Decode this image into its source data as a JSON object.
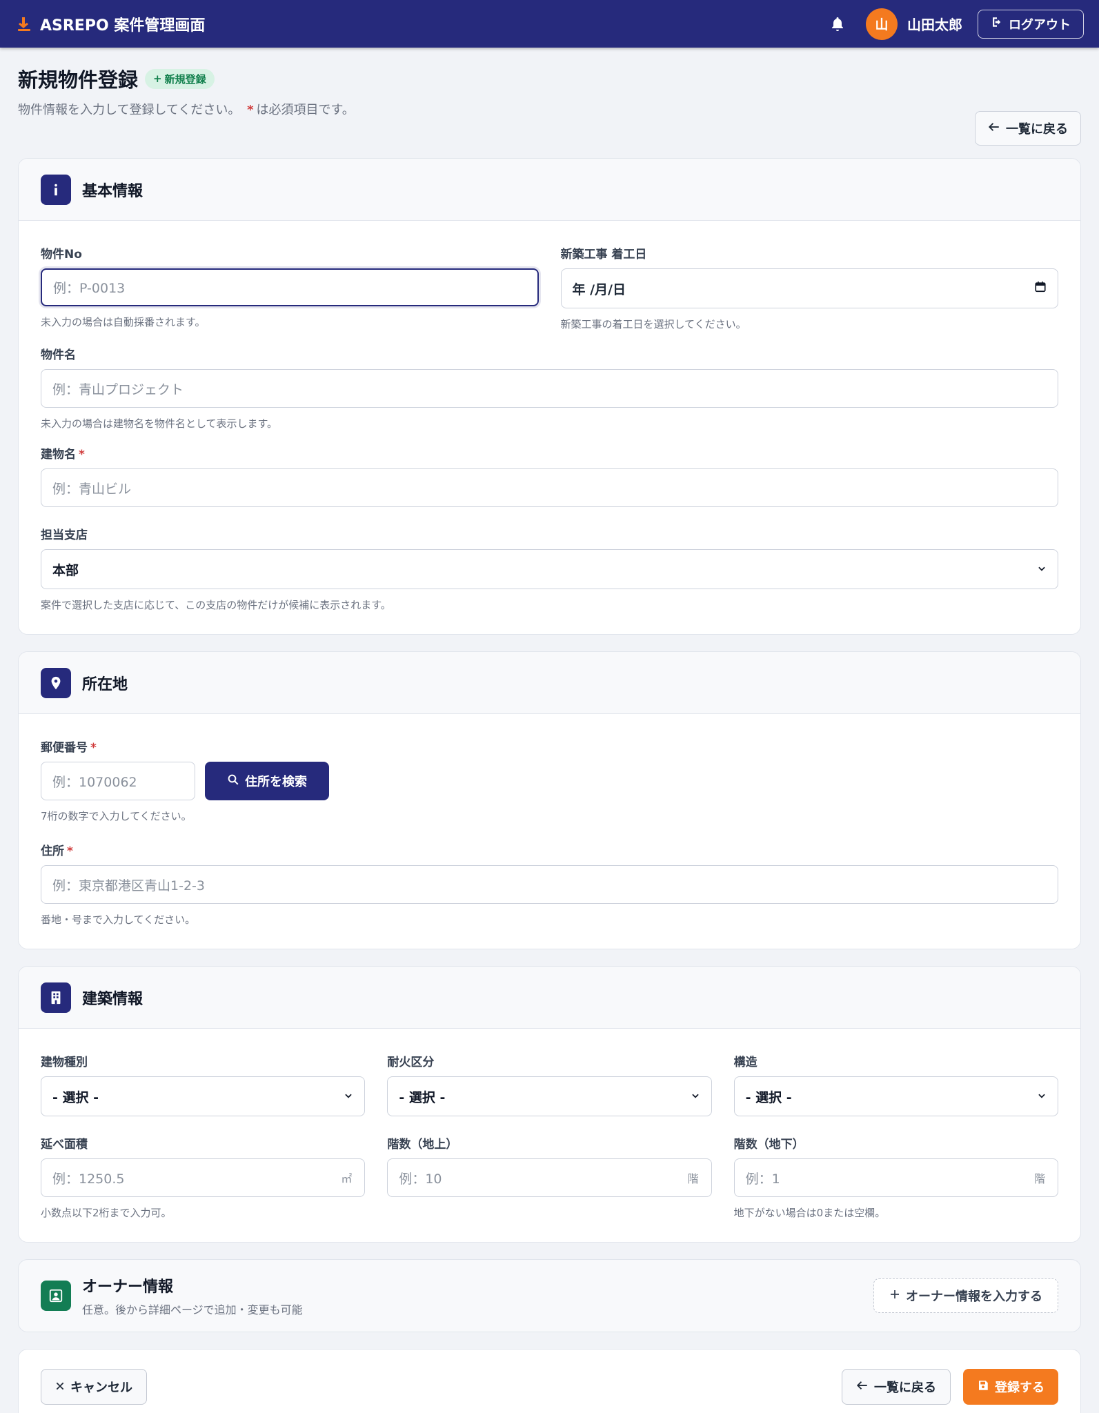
{
  "header": {
    "brand": "ASREPO 案件管理画面",
    "avatar_initial": "山",
    "user_name": "山田太郎",
    "logout_label": "ログアウト"
  },
  "page": {
    "title": "新規物件登録",
    "badge": "新規登録",
    "subtitle_before": "物件情報を入力して登録してください。",
    "subtitle_req": "*",
    "subtitle_after": "は必須項目です。",
    "back_label": "一覧に戻る"
  },
  "basic": {
    "title": "基本情報",
    "property_no": {
      "label": "物件No",
      "placeholder": "例：P-0013",
      "help": "未入力の場合は自動採番されます。"
    },
    "start_date": {
      "label": "新築工事 着工日",
      "value": "年 /月/日",
      "help": "新築工事の着工日を選択してください。"
    },
    "property_name": {
      "label": "物件名",
      "placeholder": "例：青山プロジェクト",
      "help": "未入力の場合は建物名を物件名として表示します。"
    },
    "building_name": {
      "label": "建物名",
      "required": "*",
      "placeholder": "例：青山ビル"
    },
    "branch": {
      "label": "担当支店",
      "value": "本部",
      "help": "案件で選択した支店に応じて、この支店の物件だけが候補に表示されます。"
    }
  },
  "location": {
    "title": "所在地",
    "postal": {
      "label": "郵便番号",
      "required": "*",
      "placeholder": "例：1070062",
      "search_label": "住所を検索",
      "help": "7桁の数字で入力してください。"
    },
    "address": {
      "label": "住所",
      "required": "*",
      "placeholder": "例：東京都港区青山1-2-3",
      "help": "番地・号まで入力してください。"
    }
  },
  "building": {
    "title": "建築情報",
    "type": {
      "label": "建物種別",
      "value": "- 選択 -"
    },
    "fireproof": {
      "label": "耐火区分",
      "value": "- 選択 -"
    },
    "structure": {
      "label": "構造",
      "value": "- 選択 -"
    },
    "area": {
      "label": "延べ面積",
      "placeholder": "例：1250.5",
      "unit": "㎡",
      "help": "小数点以下2桁まで入力可。"
    },
    "floors_above": {
      "label": "階数（地上）",
      "placeholder": "例：10",
      "unit": "階"
    },
    "floors_below": {
      "label": "階数（地下）",
      "placeholder": "例：1",
      "unit": "階",
      "help": "地下がない場合は0または空欄。"
    }
  },
  "owner": {
    "title": "オーナー情報",
    "subtitle": "任意。後から詳細ページで追加・変更も可能",
    "add_label": "オーナー情報を入力する"
  },
  "footer": {
    "cancel_label": "キャンセル",
    "back_label": "一覧に戻る",
    "submit_label": "登録する"
  },
  "colors": {
    "header_bg": "#262a7c",
    "accent_orange": "#f47a1f",
    "badge_green": "#12804d",
    "required_red": "#d03b3b"
  }
}
